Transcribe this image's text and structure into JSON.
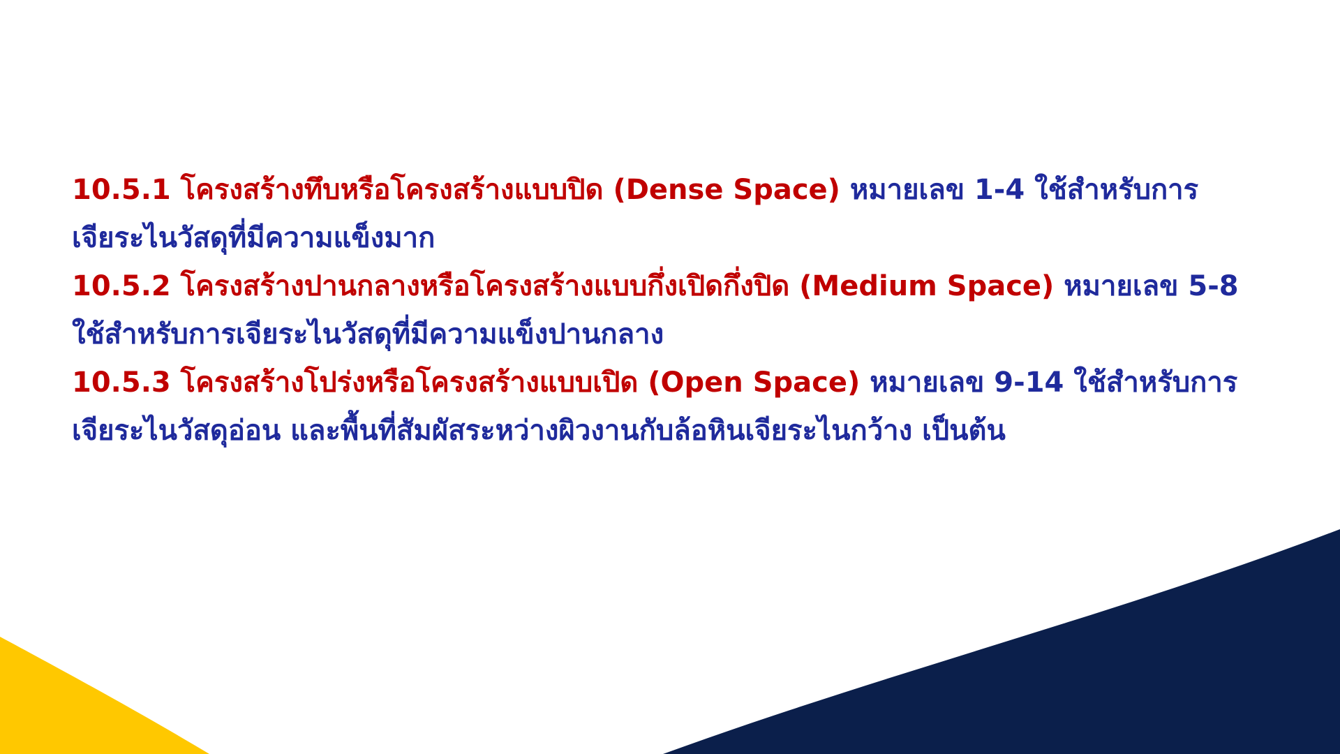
{
  "slide": {
    "colors": {
      "heading_red": "#c00000",
      "body_blue": "#1f2a9c",
      "navy_wave": "#0b1f4b",
      "yellow_wave": "#ffc800",
      "background": "#ffffff"
    },
    "items": [
      {
        "number": "10.5.1",
        "heading": "โครงสร้างทึบหรือโครงสร้างแบบปิด (Dense Space)",
        "body": "หมายเลข 1-4 ใช้สำหรับการเจียระไนวัสดุที่มีความแข็งมาก"
      },
      {
        "number": "10.5.2",
        "heading": "โครงสร้างปานกลางหรือโครงสร้างแบบกึ่งเปิดกึ่งปิด (Medium Space)",
        "body": "หมายเลข 5-8 ใช้สำหรับการเจียระไนวัสดุที่มีความแข็งปานกลาง"
      },
      {
        "number": "10.5.3",
        "heading": "โครงสร้างโปร่งหรือโครงสร้างแบบเปิด (Open Space)",
        "body": "หมายเลข 9-14 ใช้สำหรับการเจียระไนวัสดุอ่อน และพื้นที่สัมผัสระหว่างผิวงานกับล้อหินเจียระไนกว้าง เป็นต้น"
      }
    ]
  }
}
